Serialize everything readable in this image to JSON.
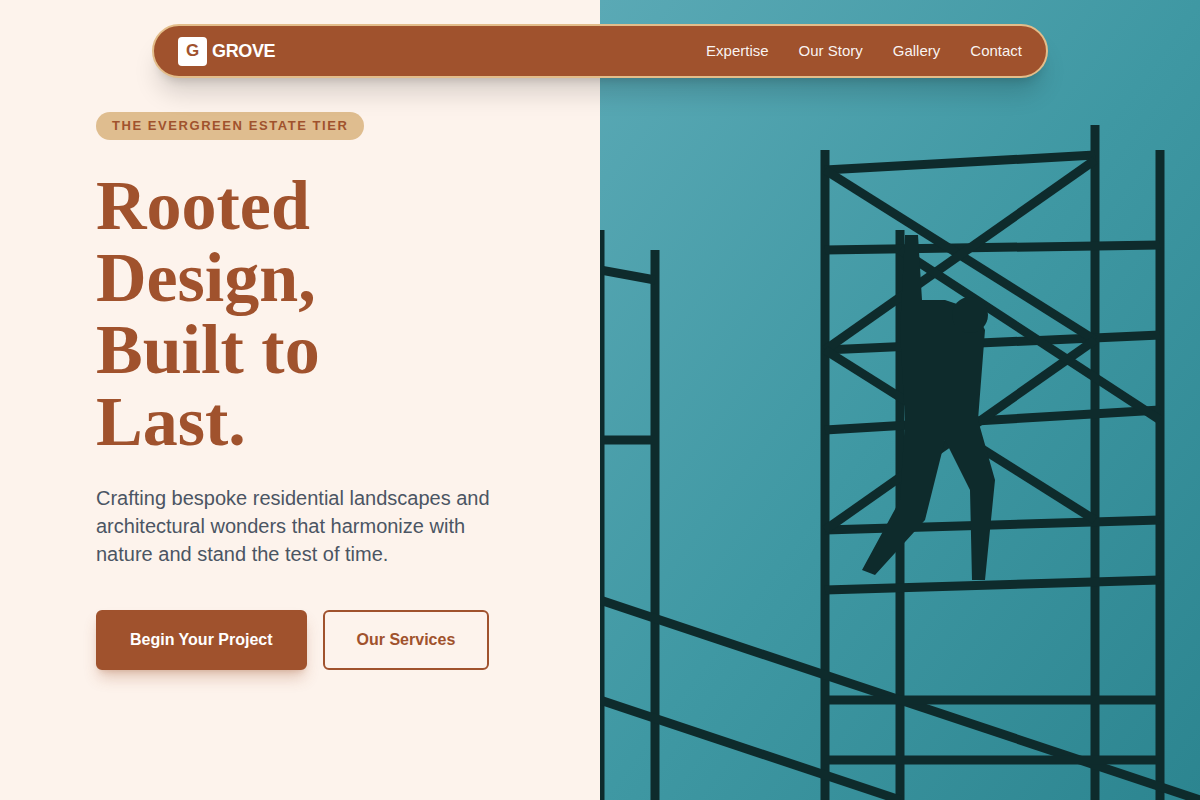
{
  "nav": {
    "logo_letter": "G",
    "brand": "GROVE",
    "links": [
      "Expertise",
      "Our Story",
      "Gallery",
      "Contact"
    ]
  },
  "hero": {
    "badge": "THE EVERGREEN ESTATE TIER",
    "title": "Rooted Design, Built to Last.",
    "subtitle": "Crafting bespoke residential landscapes and architectural wonders that harmonize with nature and stand the test of time.",
    "buttons": [
      {
        "label": "Begin Your Project",
        "kind": "primary"
      },
      {
        "label": "Our Services",
        "kind": "outline"
      }
    ]
  }
}
